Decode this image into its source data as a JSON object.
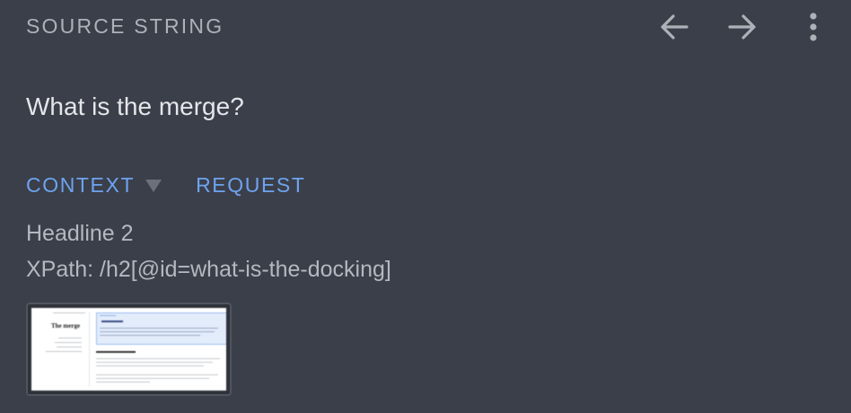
{
  "header": {
    "title": "SOURCE STRING",
    "icons": [
      "arrow-left-icon",
      "arrow-right-icon",
      "more-vertical-icon"
    ]
  },
  "source": {
    "text": "What is the merge?"
  },
  "tabs": {
    "context_label": "CONTEXT",
    "request_label": "REQUEST"
  },
  "context": {
    "element_type": "Headline 2",
    "xpath": "XPath: /h2[@id=what-is-the-docking]"
  },
  "thumbnail": {
    "heading": "The merge"
  },
  "colors": {
    "background": "#3b3f4a",
    "accent": "#6ea3f0",
    "title_text": "#aeb2b8",
    "primary_text": "#e4e6ea",
    "secondary_text": "#b4b8bf"
  }
}
